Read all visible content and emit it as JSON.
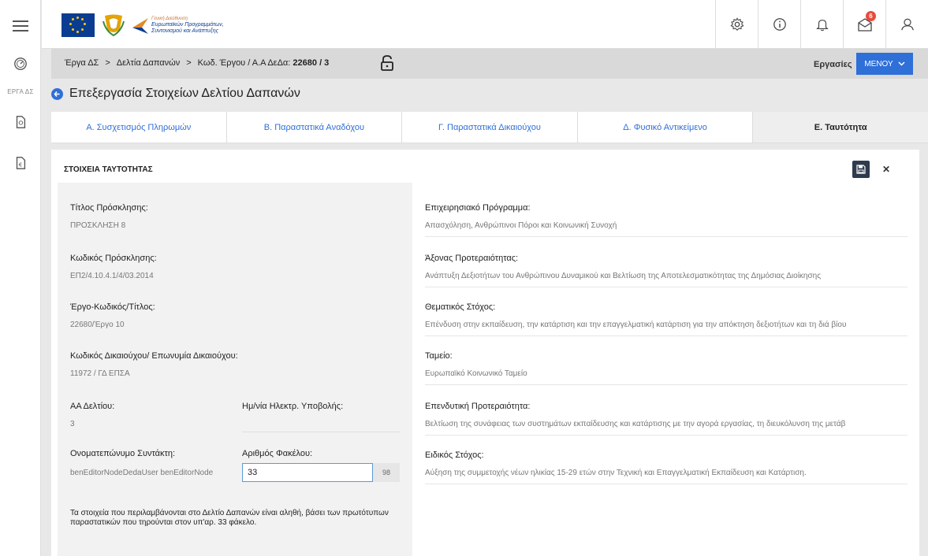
{
  "header": {
    "org_line1": "Γενική Διεύθυνση",
    "org_line2": "Ευρωπαϊκών Προγραμμάτων,",
    "org_line3": "Συντονισμού και Ανάπτυξης",
    "notifications_count": "6"
  },
  "rail": {
    "erga_label": "ΕΡΓΑ ΔΣ"
  },
  "breadcrumb": {
    "item1": "Έργα ΔΣ",
    "item2": "Δελτία Δαπανών",
    "item3_prefix": "Κωδ. Έργου / Α.Α ΔεΔα:",
    "item3_value": "22680 / 3",
    "separator": ">"
  },
  "toolbar": {
    "ergasies_label": "Εργασίες",
    "menu_label": "ΜΕΝΟΥ"
  },
  "page": {
    "title": "Επεξεργασία Στοιχείων Δελτίου Δαπανών"
  },
  "tabs": [
    {
      "label": "Α. Συσχετισμός Πληρωμών"
    },
    {
      "label": "Β. Παραστατικά Αναδόχου"
    },
    {
      "label": "Γ. Παραστατικά Δικαιούχου"
    },
    {
      "label": "Δ. Φυσικό Αντικείμενο"
    },
    {
      "label": "Ε. Ταυτότητα"
    }
  ],
  "card": {
    "title": "ΣΤΟΙΧΕΙΑ ΤΑΥΤΟΤΗΤΑΣ"
  },
  "left_fields": {
    "call_title_label": "Τίτλος Πρόσκλησης:",
    "call_title_value": "ΠΡΟΣΚΛΗΣΗ 8",
    "call_code_label": "Κωδικός Πρόσκλησης:",
    "call_code_value": "ΕΠ2/4.10.4.1/4/03.2014",
    "project_label": "Έργο-Κωδικός/Τίτλος:",
    "project_value": "22680/Έργο 10",
    "beneficiary_label": "Κωδικός Δικαιούχου/ Επωνυμία Δικαιούχου:",
    "beneficiary_value": "11972 / ΓΔ ΕΠΣΑ",
    "aa_label": "ΑΑ Δελτίου:",
    "aa_value": "3",
    "submit_date_label": "Ημ/νία Ηλεκτρ. Υποβολής:",
    "author_label": "Ονοματεπώνυμο Συντάκτη:",
    "author_value": "benEditorNodeDedaUser benEditorNode",
    "folder_label": "Αριθμός Φακέλου:",
    "folder_value": "33",
    "folder_counter": "98",
    "notice": "Τα στοιχεία που περιλαμβάνονται στο Δελτίο Δαπανών είναι αληθή, βάσει των πρωτότυπων παραστατικών που τηρούνται στον υπ'αρ. 33 φάκελο."
  },
  "right_fields": [
    {
      "label": "Επιχειρησιακό Πρόγραμμα:",
      "value": "Απασχόληση, Ανθρώπινοι Πόροι και Κοινωνική Συνοχή"
    },
    {
      "label": "Άξονας Προτεραιότητας:",
      "value": "Ανάπτυξη Δεξιοτήτων του Ανθρώπινου Δυναμικού και Βελτίωση της Αποτελεσματικότητας της Δημόσιας Διοίκησης"
    },
    {
      "label": "Θεματικός Στόχος:",
      "value": "Επένδυση στην εκπαίδευση, την κατάρτιση και την επαγγελματική κατάρτιση για την απόκτηση δεξιοτήτων και τη διά βίου"
    },
    {
      "label": "Ταμείο:",
      "value": "Ευρωπαϊκό Κοινωνικό Ταμείο"
    },
    {
      "label": "Επενδυτική Προτεραιότητα:",
      "value": "Βελτίωση της συνάφειας των συστημάτων εκπαίδευσης και κατάρτισης με την αγορά εργασίας, τη διευκόλυνση της μετάβ"
    },
    {
      "label": "Ειδικός Στόχος:",
      "value": "Αύξηση της συμμετοχής νέων ηλικίας 15-29 ετών στην Τεχνική και Επαγγελματική Εκπαίδευση και Κατάρτιση."
    }
  ],
  "colors": {
    "accent": "#2f6fd8",
    "badge": "#e74c3c",
    "save_button": "#2e3b4e"
  }
}
